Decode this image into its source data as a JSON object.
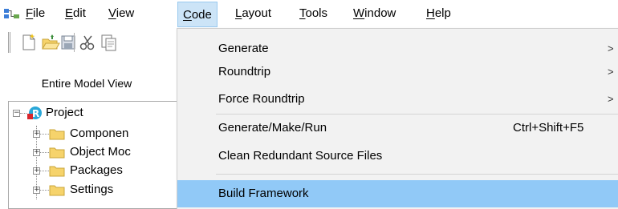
{
  "menubar": {
    "items": [
      {
        "label": "File",
        "u": "F",
        "rest": "ile"
      },
      {
        "label": "Edit",
        "u": "E",
        "rest": "dit"
      },
      {
        "label": "View",
        "u": "V",
        "rest": "iew"
      },
      {
        "label": "Code",
        "u": "C",
        "rest": "ode"
      },
      {
        "label": "Layout",
        "u": "L",
        "rest": "ayout"
      },
      {
        "label": "Tools",
        "u": "T",
        "rest": "ools"
      },
      {
        "label": "Window",
        "u": "W",
        "rest": "indow"
      },
      {
        "label": "Help",
        "u": "H",
        "rest": "elp"
      }
    ],
    "active": "Code"
  },
  "toolbar": {
    "buttons": [
      "new-file-icon",
      "open-folder-icon",
      "save-icon",
      "cut-icon",
      "copy-icon"
    ]
  },
  "panel": {
    "title": "Entire Model View"
  },
  "tree": {
    "root": {
      "label": "Project",
      "icon": "project-icon"
    },
    "children": [
      {
        "label": "Componen",
        "icon": "folder-icon"
      },
      {
        "label": "Object Moc",
        "icon": "folder-icon"
      },
      {
        "label": "Packages",
        "icon": "folder-icon"
      },
      {
        "label": "Settings",
        "icon": "folder-icon"
      }
    ]
  },
  "code_menu": {
    "items": [
      {
        "label": "Generate",
        "submenu": true
      },
      {
        "label": "Roundtrip",
        "submenu": true
      },
      {
        "label": "Force Roundtrip",
        "submenu": true
      },
      {
        "label": "Generate/Make/Run",
        "shortcut": "Ctrl+Shift+F5"
      },
      {
        "label": "Clean Redundant Source Files"
      },
      {
        "label": "Build Framework",
        "highlighted": true
      }
    ],
    "arrow_glyph": ">"
  },
  "colors": {
    "menu_active_bg": "#cce4f7",
    "dropdown_bg": "#f2f2f2",
    "highlight_bg": "#91c9f7",
    "folder_yellow": "#f6d36b"
  }
}
